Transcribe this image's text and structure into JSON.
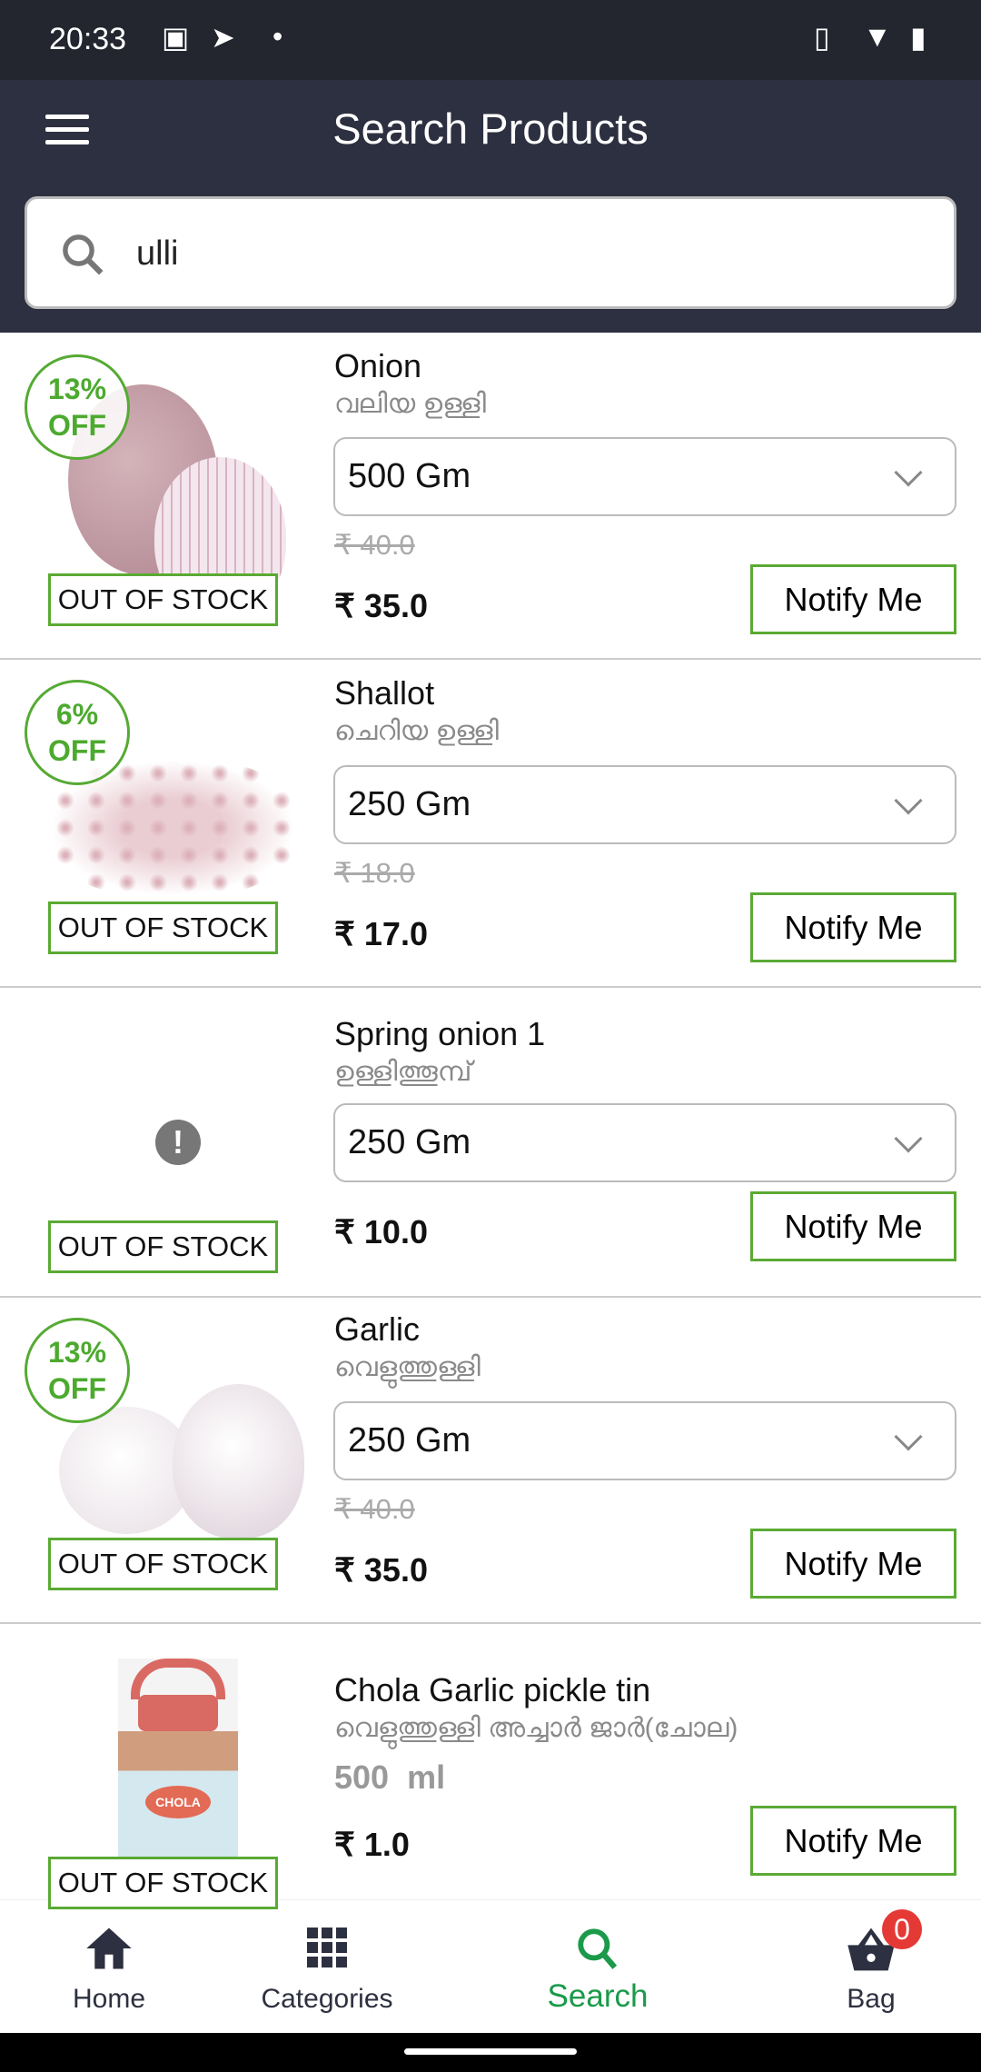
{
  "status_bar": {
    "time": "20:33",
    "icons": [
      "image-icon",
      "telegram-icon",
      "dot-icon",
      "vibrate-icon",
      "wifi-icon",
      "battery-icon"
    ]
  },
  "header": {
    "title": "Search Products",
    "menu_icon": "hamburger-icon"
  },
  "search": {
    "value": "ulli",
    "icon": "search-icon"
  },
  "colors": {
    "header": "#2d3040",
    "accent_green": "#4caa2e",
    "search_active": "#1a9a4a",
    "badge_red": "#e53935"
  },
  "products": [
    {
      "name": "Onion",
      "local_name": "വലിയ ഉള്ളി",
      "discount": "13%",
      "discount_suffix": "OFF",
      "size": "500 Gm",
      "old_price": "₹ 40.0",
      "price": "₹ 35.0",
      "stock": "OUT OF STOCK",
      "action": "Notify Me"
    },
    {
      "name": "Shallot",
      "local_name": "ചെറിയ ഉള്ളി",
      "discount": "6%",
      "discount_suffix": "OFF",
      "size": "250 Gm",
      "old_price": "₹ 18.0",
      "price": "₹ 17.0",
      "stock": "OUT OF STOCK",
      "action": "Notify Me"
    },
    {
      "name": "Spring onion 1",
      "local_name": "ഉള്ളിത്തൂമ്പ്",
      "size": "250 Gm",
      "price": "₹ 10.0",
      "stock": "OUT OF STOCK",
      "action": "Notify Me"
    },
    {
      "name": "Garlic",
      "local_name": "വെളുത്തുള്ളി",
      "discount": "13%",
      "discount_suffix": "OFF",
      "size": "250 Gm",
      "old_price": "₹ 40.0",
      "price": "₹ 35.0",
      "stock": "OUT OF STOCK",
      "action": "Notify Me"
    },
    {
      "name": "Chola Garlic pickle tin",
      "local_name": "വെളുത്തുള്ളി അച്ചാർ ജാർ(ചോല)",
      "size": "500  ml",
      "price": "₹ 1.0",
      "stock": "OUT OF STOCK",
      "action": "Notify Me",
      "image_text": "CHOLA"
    }
  ],
  "nav": {
    "items": [
      {
        "label": "Home",
        "icon": "home-icon"
      },
      {
        "label": "Categories",
        "icon": "grid-icon"
      },
      {
        "label": "Search",
        "icon": "search-icon",
        "active": true
      },
      {
        "label": "Bag",
        "icon": "basket-icon",
        "badge": "0"
      }
    ]
  }
}
